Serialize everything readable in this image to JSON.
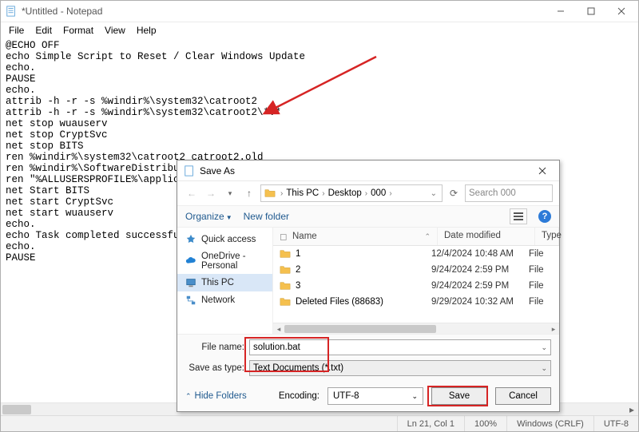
{
  "titlebar": {
    "title": "*Untitled - Notepad"
  },
  "menu": {
    "file": "File",
    "edit": "Edit",
    "format": "Format",
    "view": "View",
    "help": "Help"
  },
  "editor_text": "@ECHO OFF\necho Simple Script to Reset / Clear Windows Update\necho.\nPAUSE\necho.\nattrib -h -r -s %windir%\\system32\\catroot2\nattrib -h -r -s %windir%\\system32\\catroot2\\*.*\nnet stop wuauserv\nnet stop CryptSvc\nnet stop BITS\nren %windir%\\system32\\catroot2 catroot2.old\nren %windir%\\SoftwareDistribution sold.old\nren \"%ALLUSERSPROFILE%\\application data\\Microsoft\\Network\\downloader\" downloader.old\nnet Start BITS\nnet start CryptSvc\nnet start wuauserv\necho.\necho Task completed successfully...\necho.\nPAUSE",
  "status": {
    "pos": "Ln 21, Col 1",
    "zoom": "100%",
    "eol": "Windows (CRLF)",
    "enc": "UTF-8"
  },
  "dialog": {
    "title": "Save As",
    "crumb": [
      "This PC",
      "Desktop",
      "000"
    ],
    "search_placeholder": "Search 000",
    "toolbar": {
      "organize": "Organize",
      "newfolder": "New folder"
    },
    "sidebar": [
      {
        "label": "Quick access",
        "icon": "star"
      },
      {
        "label": "OneDrive - Personal",
        "icon": "cloud"
      },
      {
        "label": "This PC",
        "icon": "pc",
        "selected": true
      },
      {
        "label": "Network",
        "icon": "net"
      }
    ],
    "headers": {
      "name": "Name",
      "date": "Date modified",
      "type": "Type"
    },
    "rows": [
      {
        "name": "1",
        "date": "12/4/2024 10:48 AM",
        "type": "File"
      },
      {
        "name": "2",
        "date": "9/24/2024 2:59 PM",
        "type": "File"
      },
      {
        "name": "3",
        "date": "9/24/2024 2:59 PM",
        "type": "File"
      },
      {
        "name": "Deleted Files (88683)",
        "date": "9/29/2024 10:32 AM",
        "type": "File"
      }
    ],
    "filename_label": "File name:",
    "filename_value": "solution.bat",
    "saveas_label": "Save as type:",
    "saveas_value": "Text Documents (*.txt)",
    "hide": "Hide Folders",
    "encoding_label": "Encoding:",
    "encoding_value": "UTF-8",
    "save": "Save",
    "cancel": "Cancel"
  }
}
